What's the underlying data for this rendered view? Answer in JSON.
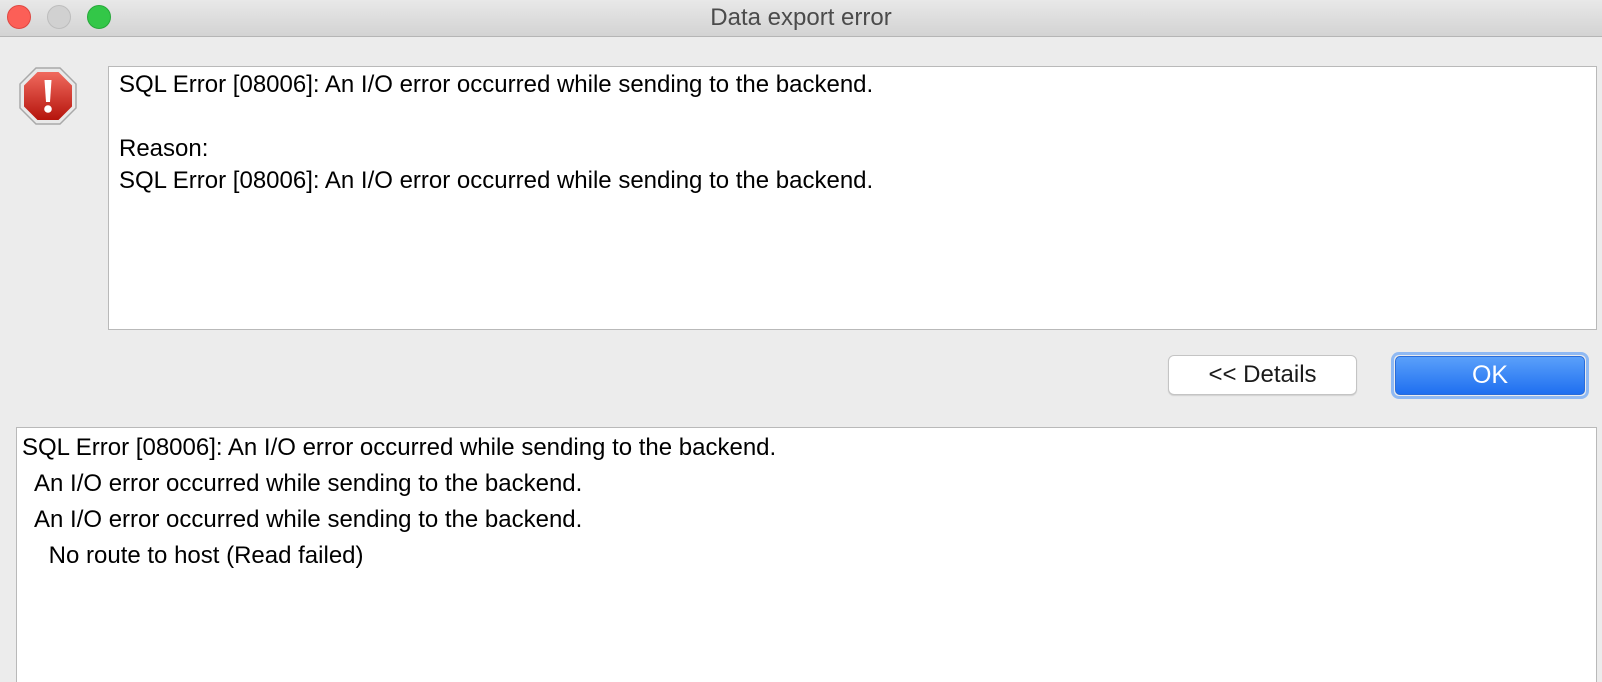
{
  "window": {
    "title": "Data export error",
    "controls": [
      "close",
      "minimize",
      "zoom"
    ]
  },
  "icon": {
    "name": "error-icon",
    "color": "#d42a22"
  },
  "message": {
    "line1": "SQL Error [08006]: An I/O error occurred while sending to the backend.",
    "reason_label": "Reason:",
    "line2": "SQL Error [08006]: An I/O error occurred while sending to the backend."
  },
  "buttons": {
    "details_label": "<< Details",
    "ok_label": "OK"
  },
  "details": {
    "lines": [
      "SQL Error [08006]: An I/O error occurred while sending to the backend.",
      "  An I/O error occurred while sending to the backend.",
      "  An I/O error occurred while sending to the backend.",
      "    No route to host (Read failed)"
    ]
  },
  "colors": {
    "accent": "#1f6ff0",
    "close": "#fc5f57",
    "zoom": "#33c748"
  }
}
